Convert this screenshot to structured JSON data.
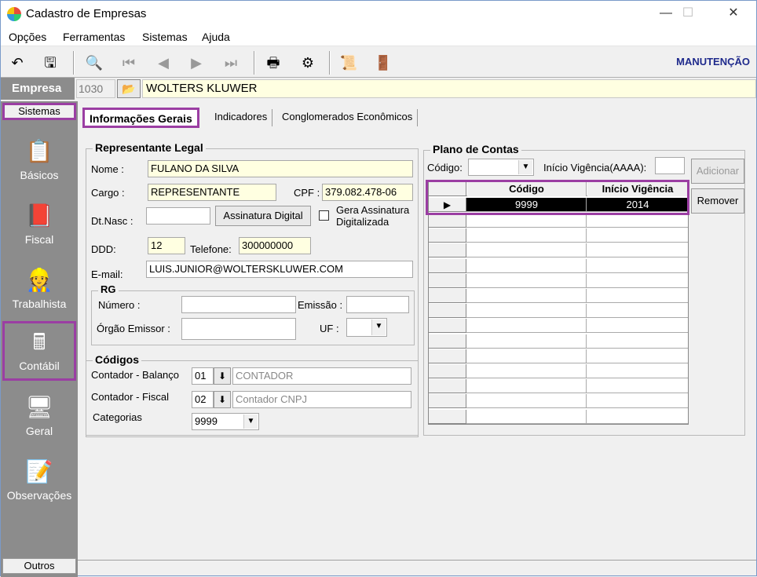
{
  "window": {
    "title": "Cadastro de Empresas",
    "minimize": "—",
    "maximize": "☐",
    "close": "✕"
  },
  "menu": [
    "Opções",
    "Ferramentas",
    "Sistemas",
    "Ajuda"
  ],
  "toolbar": {
    "mode": "MANUTENÇÃO"
  },
  "empresa": {
    "label": "Empresa",
    "code": "1030",
    "name": "WOLTERS KLUWER"
  },
  "sidebar": {
    "header": "Sistemas",
    "items": [
      "Básicos",
      "Fiscal",
      "Trabalhista",
      "Contábil",
      "Geral",
      "Observações"
    ],
    "footer": "Outros"
  },
  "tabs": [
    "Informações Gerais",
    "Indicadores",
    "Conglomerados Econômicos"
  ],
  "representante": {
    "title": "Representante Legal",
    "nome_label": "Nome :",
    "nome": "FULANO DA SILVA",
    "cargo_label": "Cargo :",
    "cargo": "REPRESENTANTE",
    "cpf_label": "CPF :",
    "cpf": "379.082.478-06",
    "dtnasc_label": "Dt.Nasc :",
    "dtnasc": "",
    "assinatura_button": "Assinatura Digital",
    "gera_assinatura_label": "Gera Assinatura Digitalizada",
    "gera_assinatura_line1": "Gera Assinatura",
    "gera_assinatura_line2": "Digitalizada",
    "ddd_label": "DDD:",
    "ddd": "12",
    "telefone_label": "Telefone:",
    "telefone": "300000000",
    "email_label": "E-mail:",
    "email": "LUIS.JUNIOR@WOLTERSKLUWER.COM"
  },
  "rg": {
    "title": "RG",
    "numero_label": "Número :",
    "numero": "",
    "emissao_label": "Emissão :",
    "emissao": "",
    "orgao_label": "Órgão Emissor :",
    "orgao": "",
    "uf_label": "UF :",
    "uf": ""
  },
  "codigos": {
    "title": "Códigos",
    "balanco_label": "Contador - Balanço",
    "balanco_code": "01",
    "balanco_name": "CONTADOR",
    "fiscal_label": "Contador - Fiscal",
    "fiscal_code": "02",
    "fiscal_name": "Contador CNPJ",
    "categorias_label": "Categorias",
    "categorias": "9999"
  },
  "plano": {
    "title": "Plano de Contas",
    "codigo_label": "Código:",
    "codigo": "",
    "inicio_label": "Início Vigência(AAAA):",
    "inicio": "",
    "add_button": "Adicionar",
    "remove_button": "Remover",
    "columns": [
      "Código",
      "Início Vigência"
    ],
    "rows": [
      {
        "codigo": "9999",
        "inicio": "2014"
      }
    ]
  }
}
